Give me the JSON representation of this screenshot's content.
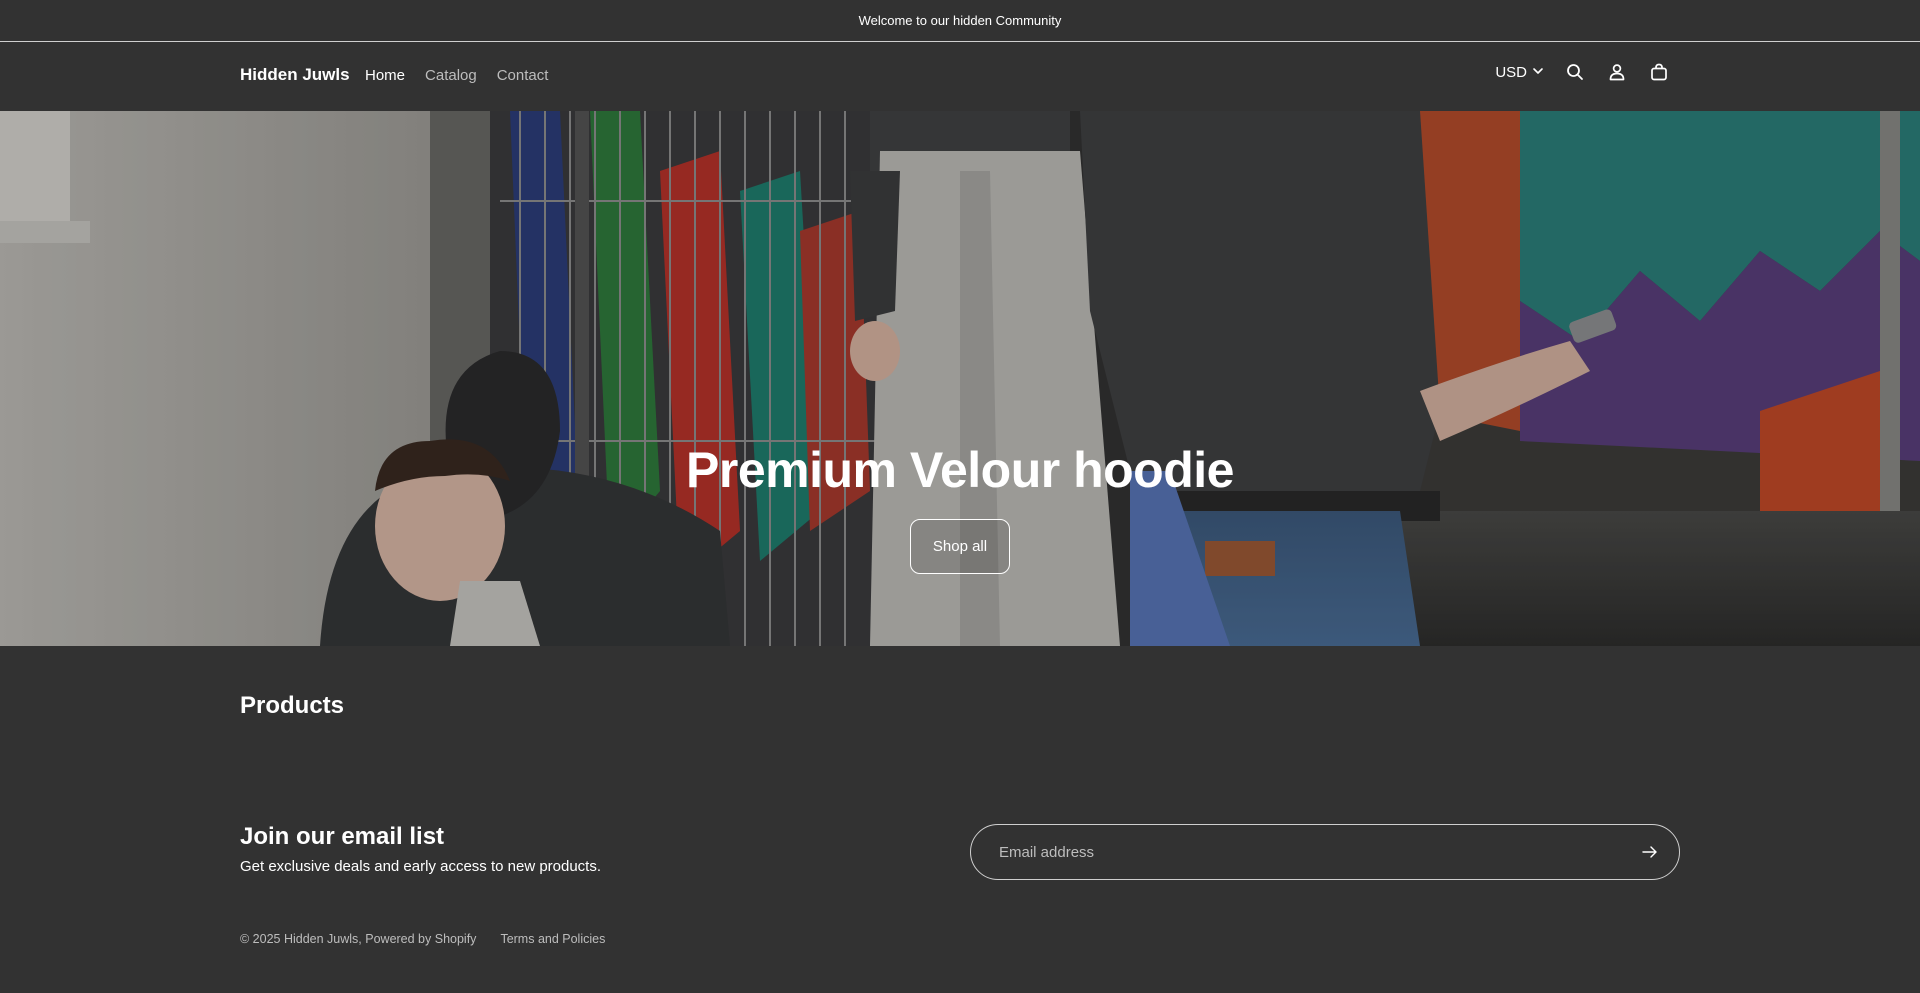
{
  "announcement": {
    "text": "Welcome to our hidden Community"
  },
  "header": {
    "brand": "Hidden Juwls",
    "nav": [
      {
        "label": "Home",
        "active": true
      },
      {
        "label": "Catalog",
        "active": false
      },
      {
        "label": "Contact",
        "active": false
      }
    ],
    "currency": "USD",
    "icons": [
      "chevron-down-icon",
      "search-icon",
      "account-icon",
      "cart-icon"
    ]
  },
  "hero": {
    "title": "Premium Velour hoodie",
    "button_label": "Shop all"
  },
  "products": {
    "title": "Products"
  },
  "newsletter": {
    "title": "Join our email list",
    "subtitle": "Get exclusive deals and early access to new products.",
    "email_placeholder": "Email address",
    "submit_icon": "arrow-right-icon"
  },
  "footer": {
    "copyright": "© 2025 Hidden Juwls, Powered by Shopify",
    "policies_link": "Terms and Policies"
  },
  "colors": {
    "background": "#323232",
    "text": "#ffffff",
    "muted_text": "#bdbdbd"
  }
}
